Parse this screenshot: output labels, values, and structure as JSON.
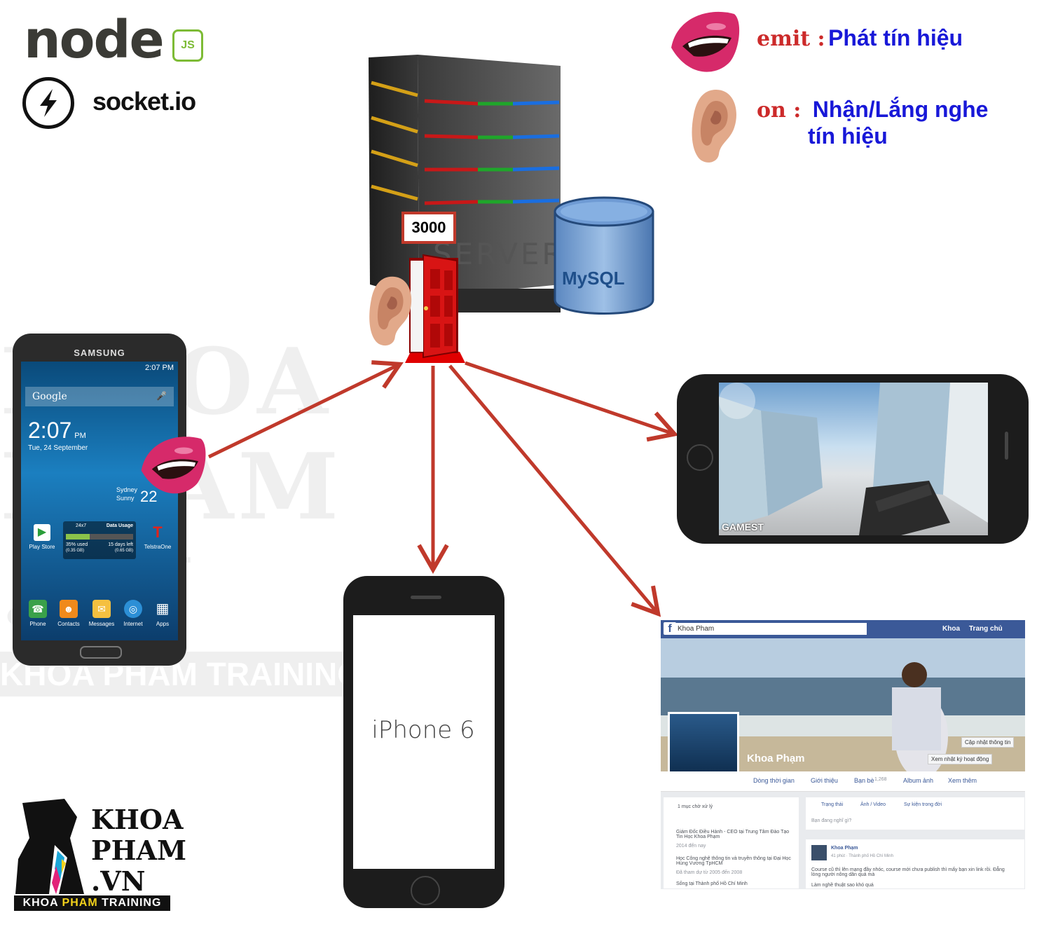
{
  "tech_logos": {
    "node_logo_text": "node",
    "node_js_badge": "JS",
    "socket_name": "socket.io"
  },
  "legend": {
    "emit_key": "emit :",
    "emit_desc": "Phát tín hiệu",
    "on_key": "on :",
    "on_desc_line1": "Nhận/Lắng nghe",
    "on_desc_line2": "tín hiệu"
  },
  "server": {
    "port": "3000",
    "label": "SERVER",
    "database": "MySQL"
  },
  "samsung_phone": {
    "brand": "SAMSUNG",
    "status_time": "2:07 PM",
    "search_label": "Google",
    "clock": "2:07",
    "clock_ampm": "PM",
    "date": "Tue, 24 September",
    "weather_city": "Sydney",
    "weather_state": "Sunny",
    "weather_temp": "22",
    "data_usage_title": "Data Usage",
    "data_usage_plan": "24x7",
    "data_usage_used": "35% used",
    "data_usage_used_gb": "(0.35 GB)",
    "data_usage_days": "15 days left",
    "data_usage_left_gb": "(0.65 GB)",
    "apps_row1": [
      "Play Store",
      "TelstraOne"
    ],
    "dock": [
      "Phone",
      "Contacts",
      "Messages",
      "Internet",
      "Apps"
    ]
  },
  "iphone": {
    "label": "iPhone 6"
  },
  "game_phone": {
    "watermark": "GAMEST"
  },
  "facebook": {
    "search_value": "Khoa Pham",
    "nav_user": "Khoa",
    "nav_home": "Trang chủ",
    "profile_name": "Khoa Phạm",
    "update_info_btn": "Cập nhật thông tin",
    "activity_log_btn": "Xem nhật ký hoạt động",
    "tabs": [
      "Dòng thời gian",
      "Giới thiệu",
      "Bạn bè",
      "Album ảnh",
      "Xem thêm"
    ],
    "friends_count": "1,268",
    "pending": "1 mục chờ xử lý",
    "about_1": "Giám Đốc Điều Hành - CEO tại Trung Tâm Đào Tạo Tin Học Khoa Phạm",
    "about_1_sub": "2014 đến nay",
    "about_2": "Học Công nghệ thông tin và truyền thông tại Đại Học Hùng Vương TpHCM",
    "about_2_sub": "Đã tham dự từ 2005 đến 2008",
    "about_3": "Sống tại Thành phố Hồ Chí Minh",
    "composer": [
      "Trạng thái",
      "Ảnh / Video",
      "Sự kiện trong đời"
    ],
    "composer_placeholder": "Bạn đang nghĩ gì?",
    "post_author": "Khoa Phạm",
    "post_meta": "41 phút · Thành phố Hồ Chí Minh",
    "post_text": "Course cũ thì lên mạng đầy nhóc, course mới chưa publish thì mấy bạn xin link rồi. Đẳng lòng người nông dân quá mà",
    "post_text_2": "Làm nghề thuật sao khó quá"
  },
  "brand": {
    "line1": "KHOA",
    "line2": "PHAM",
    "line3": ".VN",
    "band_1": "KHOA",
    "band_2": "PHAM",
    "band_3": "TRAINING"
  },
  "watermark": {
    "line1": "KHOA",
    "line2": "PHAM",
    "line3": ".VN",
    "band": "KHOA PHAM TRAINING"
  },
  "colors": {
    "arrow": "#c0392b",
    "emit_key": "#cc2a2a",
    "legend_text": "#1818d8",
    "node_green": "#7dbb35",
    "facebook_blue": "#3b5998"
  }
}
